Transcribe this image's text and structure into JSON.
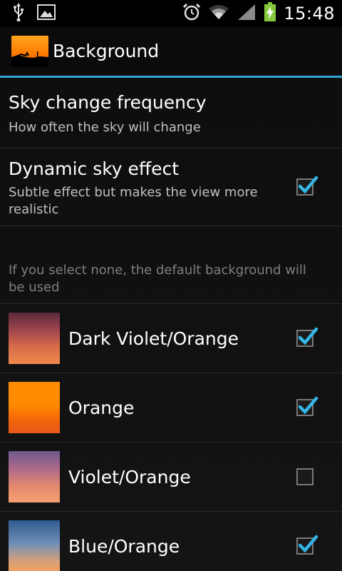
{
  "status_bar": {
    "time": "15:48",
    "icons": [
      "usb-icon",
      "image-icon",
      "alarm-icon",
      "wifi-icon",
      "signal-icon",
      "battery-charging-icon"
    ]
  },
  "action_bar": {
    "title": "Background"
  },
  "preferences": [
    {
      "title": "Sky change frequency",
      "summary": "How often the sky will change"
    },
    {
      "title": "Dynamic sky effect",
      "summary": "Subtle effect but makes the view more realistic",
      "checked": true
    }
  ],
  "category_note": "If you select none, the default background will be used",
  "skies": [
    {
      "label": "Dark Violet/Orange",
      "checked": true
    },
    {
      "label": "Orange",
      "checked": true
    },
    {
      "label": "Violet/Orange",
      "checked": false
    },
    {
      "label": "Blue/Orange",
      "checked": true
    }
  ],
  "colors": {
    "accent": "#2fa5d6",
    "checkmark": "#33b5e5",
    "battery": "#86c83b"
  }
}
